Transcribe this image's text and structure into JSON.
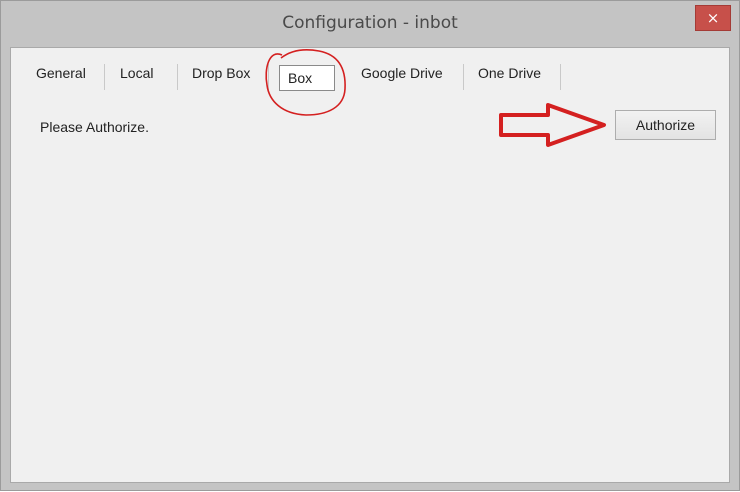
{
  "window": {
    "title": "Configuration - inbot",
    "close_glyph": "×"
  },
  "tabs": [
    {
      "label": "General"
    },
    {
      "label": "Local"
    },
    {
      "label": "Drop Box"
    },
    {
      "label": "Box",
      "selected": true
    },
    {
      "label": "Google Drive"
    },
    {
      "label": "One Drive"
    }
  ],
  "content": {
    "message": "Please Authorize.",
    "authorize_label": "Authorize"
  },
  "annotations": {
    "color": "#d42020",
    "circle_around": "Box tab",
    "arrow_points_to": "Authorize button"
  },
  "colors": {
    "titlebar": "#c4c4c4",
    "client_bg": "#f0f0f0",
    "close_button": "#c7504a"
  }
}
